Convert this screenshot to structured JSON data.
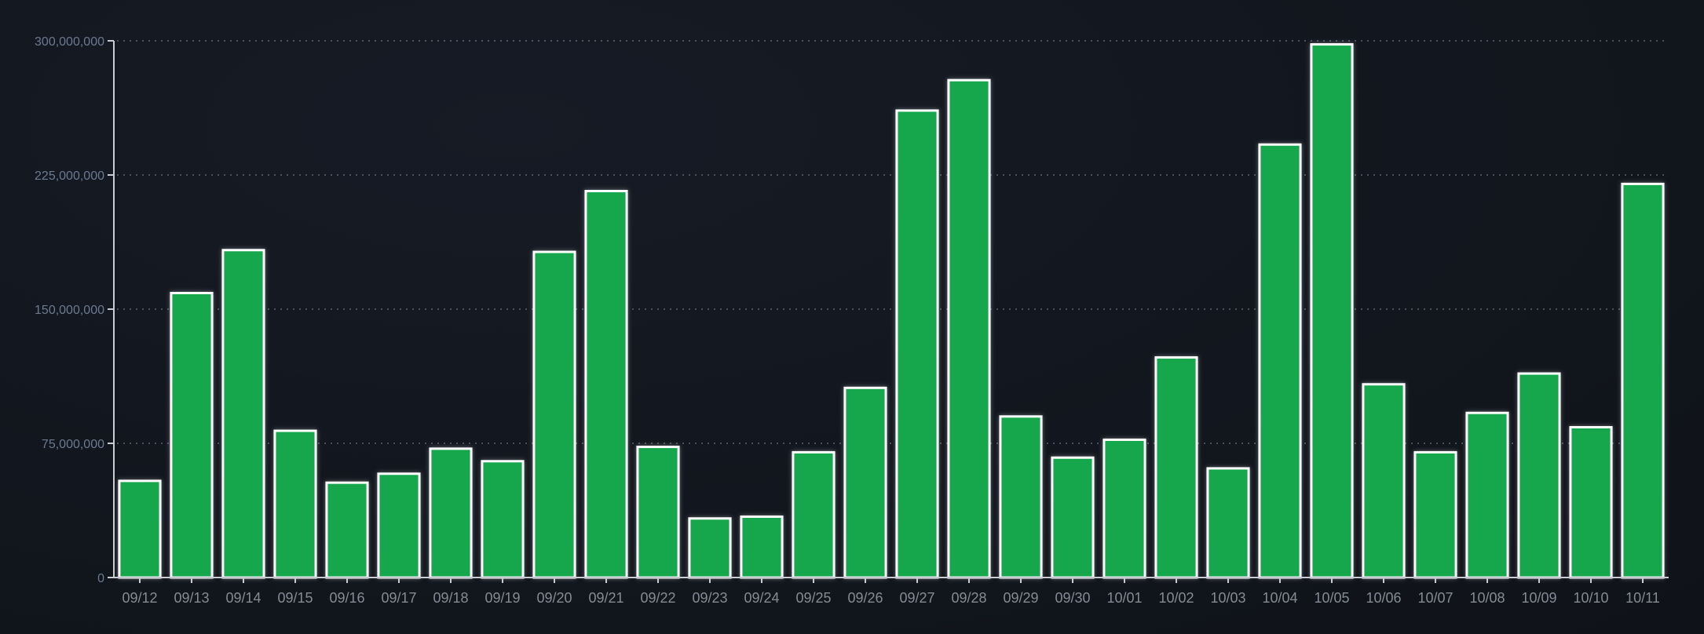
{
  "chart_data": {
    "type": "bar",
    "title": "",
    "xlabel": "",
    "ylabel": "",
    "ylim": [
      0,
      300000000
    ],
    "yticks": [
      0,
      75000000,
      150000000,
      225000000,
      300000000
    ],
    "ytick_labels": [
      "0",
      "75,000,000",
      "150,000,000",
      "225,000,000",
      "300,000,000"
    ],
    "grid": true,
    "categories": [
      "09/12",
      "09/13",
      "09/14",
      "09/15",
      "09/16",
      "09/17",
      "09/18",
      "09/19",
      "09/20",
      "09/21",
      "09/22",
      "09/23",
      "09/24",
      "09/25",
      "09/26",
      "09/27",
      "09/28",
      "09/29",
      "09/30",
      "10/01",
      "10/02",
      "10/03",
      "10/04",
      "10/05",
      "10/06",
      "10/07",
      "10/08",
      "10/09",
      "10/10",
      "10/11"
    ],
    "values": [
      54000000,
      159000000,
      183000000,
      82000000,
      53000000,
      58000000,
      72000000,
      65000000,
      182000000,
      216000000,
      73000000,
      33000000,
      34000000,
      70000000,
      106000000,
      261000000,
      278000000,
      90000000,
      67000000,
      77000000,
      123000000,
      61000000,
      242000000,
      298000000,
      108000000,
      70000000,
      92000000,
      114000000,
      84000000,
      220000000
    ],
    "colors": {
      "bar": "#18a64b",
      "bar_stroke": "#ffffff",
      "background": "#12161f"
    }
  }
}
